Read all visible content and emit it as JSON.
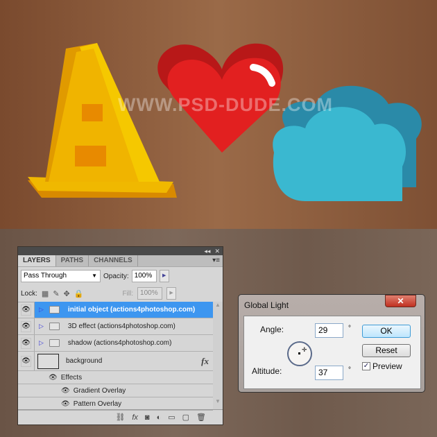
{
  "artwork": {
    "watermark": "WWW.PSD-DUDE.COM"
  },
  "layers_panel": {
    "tabs": [
      {
        "label": "LAYERS",
        "active": true
      },
      {
        "label": "PATHS",
        "active": false
      },
      {
        "label": "CHANNELS",
        "active": false
      }
    ],
    "blend_mode": "Pass Through",
    "opacity_label": "Opacity:",
    "opacity_value": "100%",
    "lock_label": "Lock:",
    "fill_label": "Fill:",
    "fill_value": "100%",
    "layers": [
      {
        "name": "initial object (actions4photoshop.com)",
        "type": "group",
        "selected": true
      },
      {
        "name": "3D effect (actions4photoshop.com)",
        "type": "group"
      },
      {
        "name": "shadow (actions4photoshop.com)",
        "type": "group"
      },
      {
        "name": "background",
        "type": "layer",
        "fx": "fx"
      }
    ],
    "effects_label": "Effects",
    "effects": [
      "Gradient Overlay",
      "Pattern Overlay"
    ]
  },
  "dialog": {
    "title": "Global Light",
    "close": "✕",
    "angle_label": "Angle:",
    "angle_value": "29",
    "altitude_label": "Altitude:",
    "altitude_value": "37",
    "degree": "°",
    "ok": "OK",
    "reset": "Reset",
    "preview_label": "Preview",
    "preview_checked": true
  },
  "colors": {
    "selection": "#3d96f0",
    "cone": "#f0b400",
    "heart": "#e02020",
    "cloud": "#3ab8d0"
  }
}
